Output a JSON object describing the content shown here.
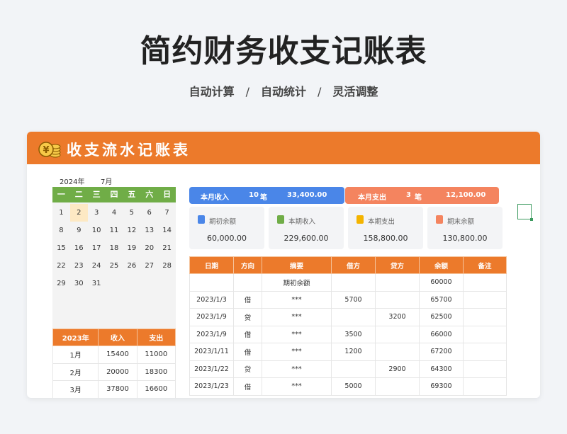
{
  "page": {
    "title": "简约财务收支记账表",
    "subtitle_items": [
      "自动计算",
      "自动统计",
      "灵活调整"
    ],
    "subtitle_sep": "/"
  },
  "card": {
    "title": "收支流水记账表",
    "icon": "coin-stack-icon",
    "accent": "#ec7a2b"
  },
  "calendar": {
    "year": "2024年",
    "month": "7月",
    "weekdays": [
      "一",
      "二",
      "三",
      "四",
      "五",
      "六",
      "日"
    ],
    "today": "2",
    "weeks": [
      [
        "1",
        "2",
        "3",
        "4",
        "5",
        "6",
        "7"
      ],
      [
        "8",
        "9",
        "10",
        "11",
        "12",
        "13",
        "14"
      ],
      [
        "15",
        "16",
        "17",
        "18",
        "19",
        "20",
        "21"
      ],
      [
        "22",
        "23",
        "24",
        "25",
        "26",
        "27",
        "28"
      ],
      [
        "29",
        "30",
        "31",
        "",
        "",
        "",
        ""
      ]
    ]
  },
  "monthly": {
    "headers": [
      "2023年",
      "收入",
      "支出"
    ],
    "rows": [
      [
        "1月",
        "15400",
        "11000"
      ],
      [
        "2月",
        "20000",
        "18300"
      ],
      [
        "3月",
        "37800",
        "16600"
      ]
    ]
  },
  "summary": {
    "income": {
      "label": "本月收入",
      "count": "10",
      "unit": "笔",
      "amount": "33,400.00"
    },
    "expense": {
      "label": "本月支出",
      "count": "3",
      "unit": "笔",
      "amount": "12,100.00"
    }
  },
  "stats": [
    {
      "label": "期初余额",
      "value": "60,000.00",
      "icon": "book-icon",
      "color": "#4a86e8"
    },
    {
      "label": "本期收入",
      "value": "229,600.00",
      "icon": "income-icon",
      "color": "#70ad47"
    },
    {
      "label": "本期支出",
      "value": "158,800.00",
      "icon": "expense-icon",
      "color": "#f4b400"
    },
    {
      "label": "期末余额",
      "value": "130,800.00",
      "icon": "balance-icon",
      "color": "#f4845f"
    }
  ],
  "ledger": {
    "headers": [
      "日期",
      "方向",
      "摘要",
      "借方",
      "贷方",
      "余额",
      "备注"
    ],
    "rows": [
      [
        "",
        "",
        "期初余额",
        "",
        "",
        "60000",
        ""
      ],
      [
        "2023/1/3",
        "借",
        "***",
        "5700",
        "",
        "65700",
        ""
      ],
      [
        "2023/1/9",
        "贷",
        "***",
        "",
        "3200",
        "62500",
        ""
      ],
      [
        "2023/1/9",
        "借",
        "***",
        "3500",
        "",
        "66000",
        ""
      ],
      [
        "2023/1/11",
        "借",
        "***",
        "1200",
        "",
        "67200",
        ""
      ],
      [
        "2023/1/22",
        "贷",
        "***",
        "",
        "2900",
        "64300",
        ""
      ],
      [
        "2023/1/23",
        "借",
        "***",
        "5000",
        "",
        "69300",
        ""
      ]
    ]
  }
}
